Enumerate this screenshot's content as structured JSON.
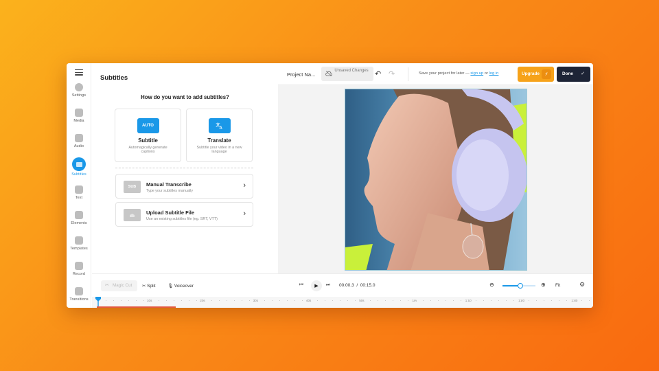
{
  "sidebar": {
    "items": [
      {
        "label": "Settings",
        "icon": "settings-icon"
      },
      {
        "label": "Media",
        "icon": "media-icon"
      },
      {
        "label": "Audio",
        "icon": "audio-icon"
      },
      {
        "label": "Subtitles",
        "icon": "subtitles-icon",
        "active": true
      },
      {
        "label": "Text",
        "icon": "text-icon"
      },
      {
        "label": "Elements",
        "icon": "elements-icon"
      },
      {
        "label": "Templates",
        "icon": "templates-icon"
      },
      {
        "label": "Record",
        "icon": "record-icon"
      },
      {
        "label": "Transitions",
        "icon": "transitions-icon"
      }
    ]
  },
  "panel": {
    "title": "Subtitles",
    "question": "How do you want to add subtitles?",
    "cards": [
      {
        "badge": "AUTO",
        "title": "Subtitle",
        "desc": "Automagically generate captions"
      },
      {
        "badge": "",
        "title": "Translate",
        "desc": "Subtitle your video in a new language"
      }
    ],
    "rows": [
      {
        "thumb": "SUB",
        "title": "Manual Transcribe",
        "desc": "Type your subtitles manually"
      },
      {
        "thumb": "",
        "title": "Upload Subtitle File",
        "desc": "Use an existing subtitles file (eg. SRT, VTT)"
      }
    ]
  },
  "topbar": {
    "project_name": "Project Na...",
    "unsaved": "Unsaved Changes",
    "save_prefix": "Save your project for later —",
    "sign_up": "sign up",
    "or": "or",
    "log_in": "log in",
    "upgrade": "Upgrade",
    "done": "Done"
  },
  "toolbar": {
    "magic_cut": "Magic Cut",
    "split": "Split",
    "voiceover": "Voiceover",
    "current_time": "00:00.3",
    "separator": "/",
    "total_time": "00:15.0",
    "fit": "Fit",
    "zoom_level": 0.55
  },
  "timeline": {
    "ticks": [
      "10s",
      "20s",
      "30s",
      "40s",
      "50s",
      "1m",
      "1:10",
      "1:20",
      "1:30"
    ]
  },
  "colors": {
    "accent": "#1a98e8",
    "upgrade": "#f6a21a",
    "done": "#1d2436",
    "video_shape": "#c9f03a"
  }
}
